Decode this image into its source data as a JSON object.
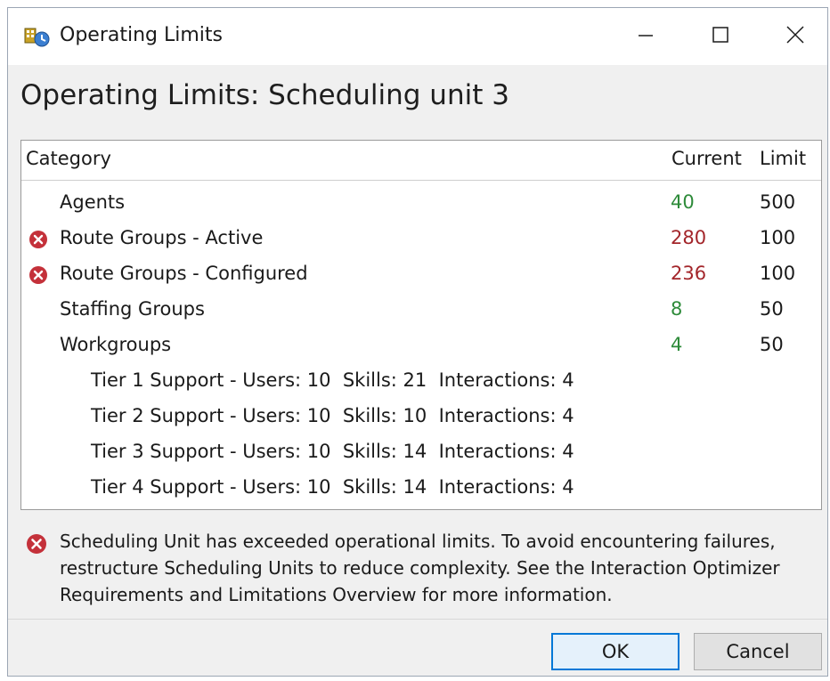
{
  "window": {
    "title": "Operating Limits",
    "heading": "Operating Limits: Scheduling unit 3"
  },
  "table": {
    "columns": [
      "Category",
      "Current",
      "Limit"
    ],
    "rows": [
      {
        "label": "Agents",
        "current": "40",
        "limit": "500",
        "error": false
      },
      {
        "label": "Route Groups - Active",
        "current": "280",
        "limit": "100",
        "error": true
      },
      {
        "label": "Route Groups - Configured",
        "current": "236",
        "limit": "100",
        "error": true
      },
      {
        "label": "Staffing Groups",
        "current": "8",
        "limit": "50",
        "error": false
      },
      {
        "label": "Workgroups",
        "current": "4",
        "limit": "50",
        "error": false
      }
    ],
    "workgroups": [
      "Tier 1 Support - Users: 10  Skills: 21  Interactions: 4",
      "Tier 2 Support - Users: 10  Skills: 10  Interactions: 4",
      "Tier 3 Support - Users: 10  Skills: 14  Interactions: 4",
      "Tier 4 Support - Users: 10  Skills: 14  Interactions: 4"
    ]
  },
  "warning": {
    "message": "Scheduling Unit has exceeded operational limits. To avoid encountering failures, restructure Scheduling Units to reduce complexity. See the Interaction Optimizer Requirements and Limitations Overview for more information."
  },
  "buttons": {
    "ok": "OK",
    "cancel": "Cancel"
  },
  "colors": {
    "within_limit": "#2e8b3a",
    "over_limit": "#a3262b",
    "error_icon": "#c4313a"
  },
  "icons": {
    "app": "scheduling-app-icon",
    "error": "error-circle-icon",
    "minimize": "minimize-icon",
    "maximize": "maximize-icon",
    "close": "close-icon"
  }
}
